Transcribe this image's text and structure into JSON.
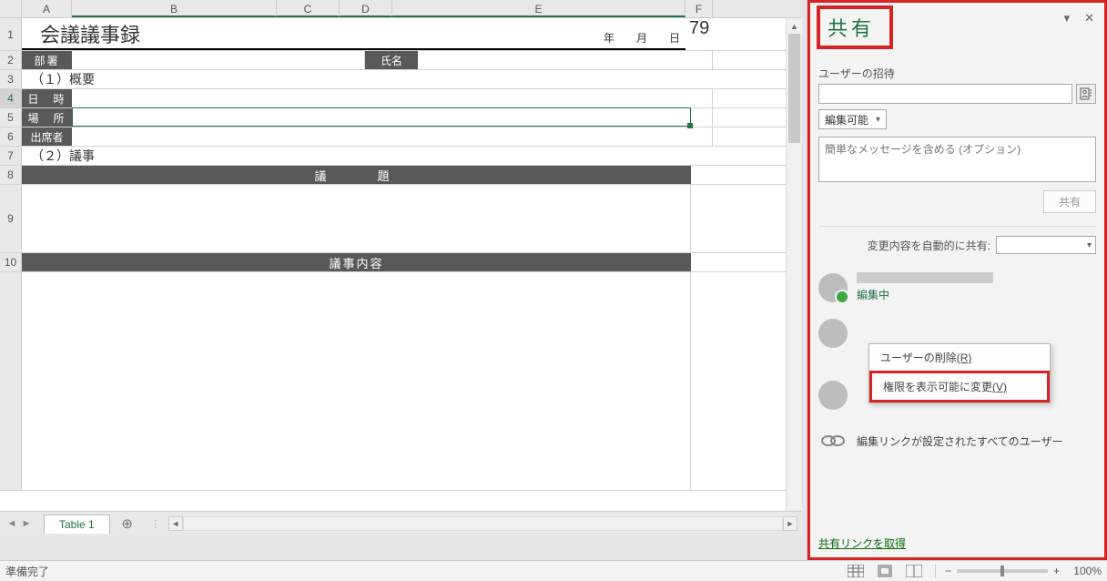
{
  "columns": {
    "A": "A",
    "B": "B",
    "C": "C",
    "D": "D",
    "E": "E",
    "F": "F"
  },
  "rows": {
    "1": "1",
    "2": "2",
    "3": "3",
    "4": "4",
    "5": "5",
    "6": "6",
    "7": "7",
    "8": "8",
    "9": "9",
    "10": "10"
  },
  "doc": {
    "title": "会議議事録",
    "date_label": "年　　月　　日",
    "f1_value": "79",
    "labels": {
      "busho": "部署",
      "shimei": "氏名",
      "section1": "（１）概要",
      "nichiji": "日　時",
      "basho": "場　所",
      "shusseki": "出席者",
      "section2": "（２）議事",
      "gidai": "議　　題",
      "giji_naiyo": "議事内容"
    }
  },
  "tabs": {
    "sheet1": "Table 1"
  },
  "status": {
    "ready": "準備完了",
    "zoom": "100%"
  },
  "share_pane": {
    "title": "共有",
    "invite_label": "ユーザーの招待",
    "permission": "編集可能",
    "message_placeholder": "簡単なメッセージを含める (オプション)",
    "share_button": "共有",
    "auto_share_label": "変更内容を自動的に共有:",
    "editing_status": "編集中",
    "context": {
      "remove": "ユーザーの削除",
      "remove_key": "(R)",
      "change_perm": "権限を表示可能に変更",
      "change_perm_key": "(V)"
    },
    "edit_link_text": "編集リンクが設定されたすべてのユーザー",
    "get_link": "共有リンクを取得"
  }
}
